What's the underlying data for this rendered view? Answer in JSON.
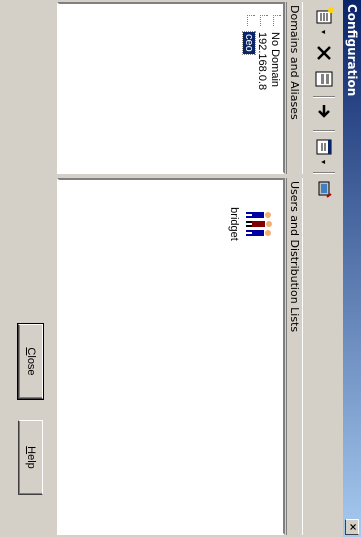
{
  "window": {
    "title": "Configuration",
    "close_glyph": "×"
  },
  "toolbar": {
    "buttons": [
      {
        "name": "new-icon",
        "glyph": "▤"
      },
      {
        "name": "delete-icon",
        "glyph": "✕"
      },
      {
        "name": "properties-icon",
        "glyph": "▦"
      },
      {
        "name": "move-icon",
        "glyph": "➔"
      },
      {
        "name": "view-icon",
        "glyph": "▣"
      },
      {
        "name": "connect-icon",
        "glyph": "◍"
      }
    ],
    "dropdown_glyph": "▾"
  },
  "domains_pane": {
    "header": "Domains and Aliases",
    "items": [
      {
        "label": "No Domain",
        "selected": false
      },
      {
        "label": "192.168.0.8",
        "selected": false
      },
      {
        "label": "ceo",
        "selected": true
      }
    ]
  },
  "users_pane": {
    "header": "Users and Distribution Lists",
    "items": [
      {
        "label": "bridget",
        "icon": "users-group-icon"
      }
    ]
  },
  "buttons": {
    "close": {
      "accel": "C",
      "rest": "lose"
    },
    "help": {
      "accel": "H",
      "rest": "elp"
    }
  },
  "colors": {
    "titlebar_start": "#0a246a",
    "selection": "#0a246a",
    "face": "#d4d0c8"
  }
}
